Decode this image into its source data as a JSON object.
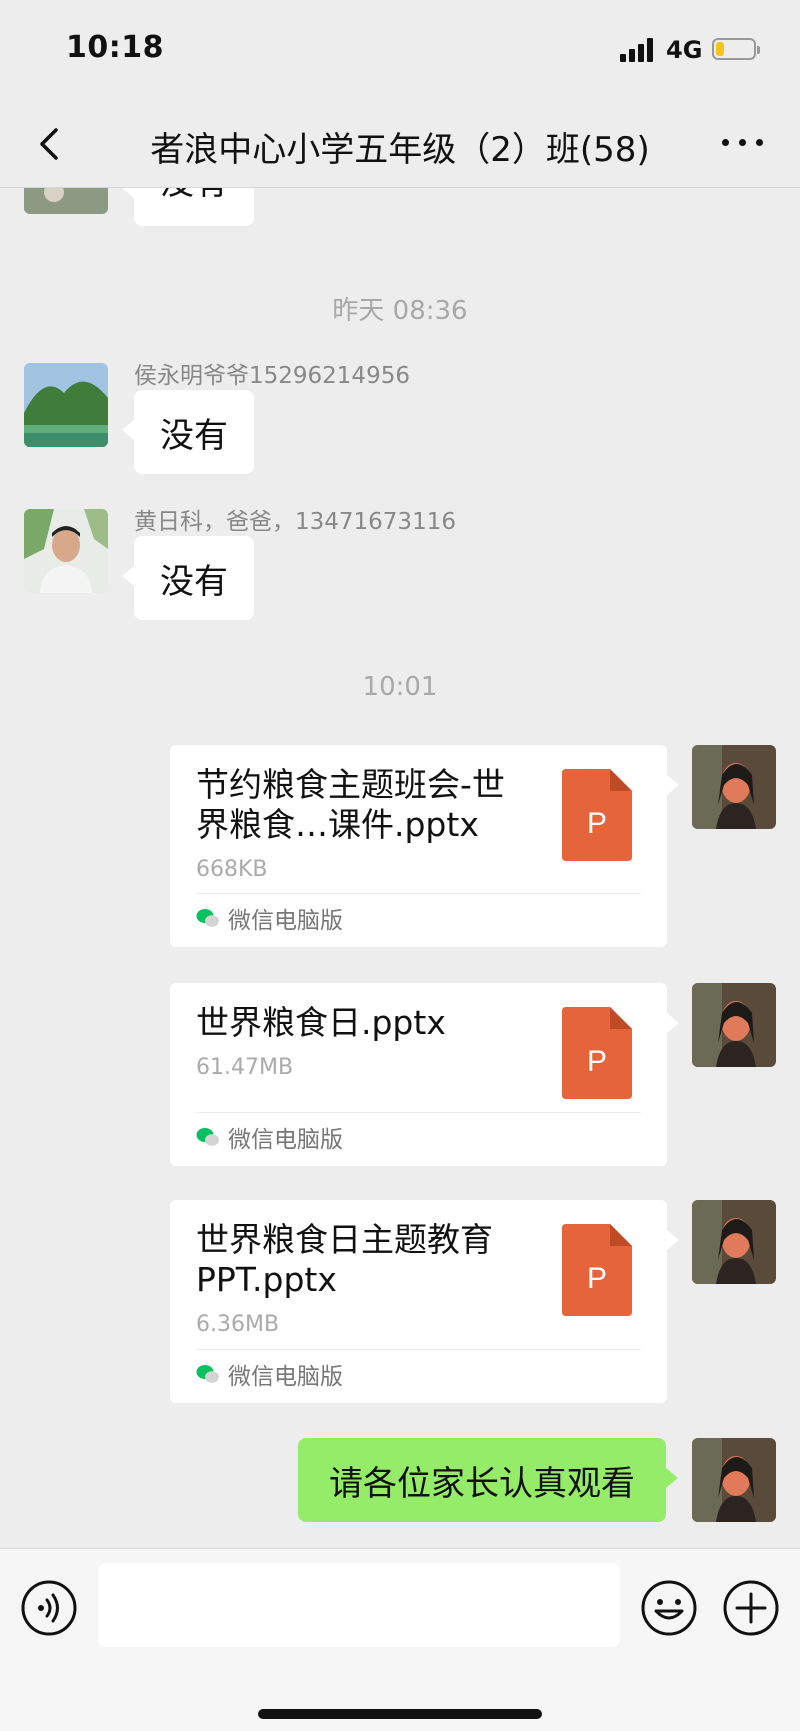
{
  "status_bar": {
    "time": "10:18",
    "network": "4G",
    "battery_level": 0.22
  },
  "header": {
    "title": "者浪中心小学五年级（2）班(58)",
    "back_icon": "chevron-left-icon",
    "more_icon": "more-icon"
  },
  "messages": {
    "partial_top": {
      "text": "没有"
    },
    "time_1": "昨天 08:36",
    "msg_1": {
      "sender": "侯永明爷爷15296214956",
      "text": "没有"
    },
    "msg_2": {
      "sender": "黄日科，爸爸，13471673116",
      "text": "没有"
    },
    "time_2": "10:01",
    "files": [
      {
        "name": "节约粮食主题班会-世界粮食…课件.pptx",
        "size": "668KB",
        "source": "微信电脑版",
        "icon_letter": "P"
      },
      {
        "name": "世界粮食日.pptx",
        "size": "61.47MB",
        "source": "微信电脑版",
        "icon_letter": "P"
      },
      {
        "name": "世界粮食日主题教育PPT.pptx",
        "size": "6.36MB",
        "source": "微信电脑版",
        "icon_letter": "P"
      }
    ],
    "msg_self": {
      "text": "请各位家长认真观看"
    }
  },
  "input_bar": {
    "placeholder": "",
    "voice_icon": "voice-icon",
    "emoji_icon": "emoji-icon",
    "plus_icon": "plus-icon"
  },
  "colors": {
    "background": "#ededed",
    "self_bubble": "#95ec69",
    "ppt_icon": "#e5643c",
    "wechat_green": "#07c160"
  }
}
